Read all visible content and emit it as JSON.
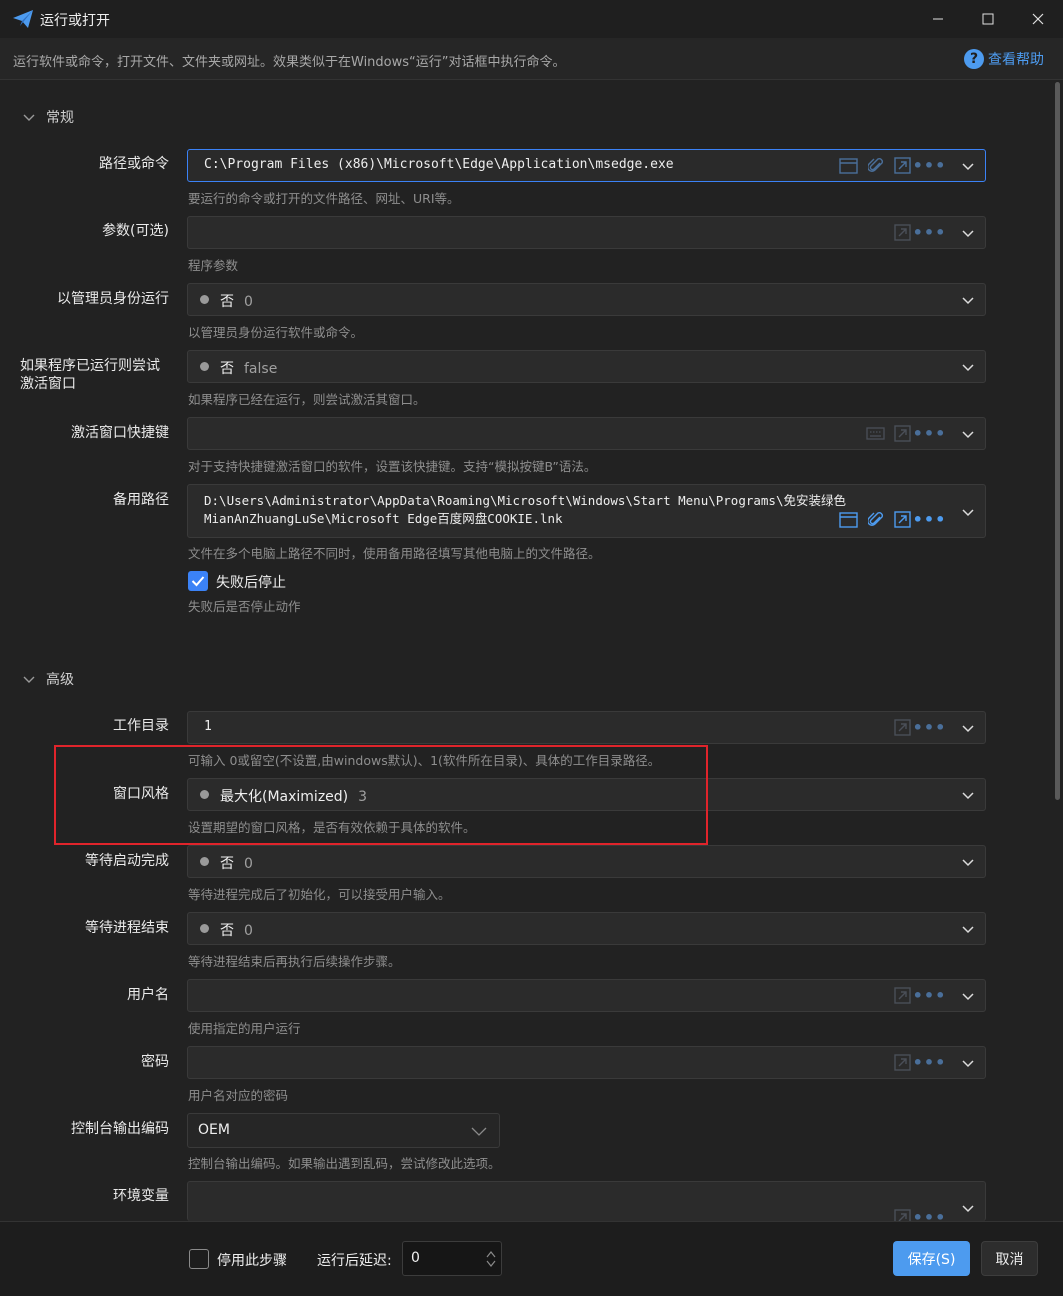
{
  "window": {
    "title": "运行或打开",
    "description": "运行软件或命令，打开文件、文件夹或网址。效果类似于在Windows“运行”对话框中执行命令。",
    "help_label": "查看帮助"
  },
  "sections": {
    "general": "常规",
    "advanced": "高级"
  },
  "fields": {
    "path": {
      "label": "路径或命令",
      "value": "C:\\Program Files (x86)\\Microsoft\\Edge\\Application\\msedge.exe",
      "hint": "要运行的命令或打开的文件路径、网址、URI等。"
    },
    "args": {
      "label": "参数(可选)",
      "value": "",
      "hint": "程序参数"
    },
    "admin": {
      "label": "以管理员身份运行",
      "selected": "否",
      "selected_value": "0",
      "hint": "以管理员身份运行软件或命令。"
    },
    "activate": {
      "label": "如果程序已运行则尝试激活窗口",
      "selected": "否",
      "selected_value": "false",
      "hint": "如果程序已经在运行，则尝试激活其窗口。"
    },
    "hotkey": {
      "label": "激活窗口快捷键",
      "value": "",
      "hint": "对于支持快捷键激活窗口的软件，设置该快捷键。支持“模拟按键B”语法。"
    },
    "backup": {
      "label": "备用路径",
      "line1": "D:\\Users\\Administrator\\AppData\\Roaming\\Microsoft\\Windows\\Start Menu\\Programs\\免安装绿色",
      "line2": "MianAnZhuangLuSe\\Microsoft Edge百度网盘COOKIE.lnk",
      "hint": "文件在多个电脑上路径不同时，使用备用路径填写其他电脑上的文件路径。"
    },
    "stop_on_fail": {
      "label": "失败后停止",
      "checked": true,
      "hint": "失败后是否停止动作"
    },
    "workdir": {
      "label": "工作目录",
      "value": "1",
      "hint": "可输入 0或留空(不设置,由windows默认)、1(软件所在目录)、具体的工作目录路径。"
    },
    "window_style": {
      "label": "窗口风格",
      "selected": "最大化(Maximized)",
      "selected_value": "3",
      "hint": "设置期望的窗口风格，是否有效依赖于具体的软件。"
    },
    "wait_start": {
      "label": "等待启动完成",
      "selected": "否",
      "selected_value": "0",
      "hint": "等待进程完成后了初始化，可以接受用户输入。"
    },
    "wait_end": {
      "label": "等待进程结束",
      "selected": "否",
      "selected_value": "0",
      "hint": "等待进程结束后再执行后续操作步骤。"
    },
    "username": {
      "label": "用户名",
      "value": "",
      "hint": "使用指定的用户运行"
    },
    "password": {
      "label": "密码",
      "value": "",
      "hint": "用户名对应的密码"
    },
    "encoding": {
      "label": "控制台输出编码",
      "selected": "OEM",
      "hint": "控制台输出编码。如果输出遇到乱码，尝试修改此选项。"
    },
    "env": {
      "label": "环境变量",
      "value": ""
    }
  },
  "footer": {
    "disable_label": "停用此步骤",
    "disable_checked": false,
    "delay_label": "运行后延迟:",
    "delay_value": "0",
    "save_label": "保存(S)",
    "cancel_label": "取消"
  },
  "colors": {
    "accent": "#4d9bef",
    "highlight_box": "#e0242b"
  }
}
